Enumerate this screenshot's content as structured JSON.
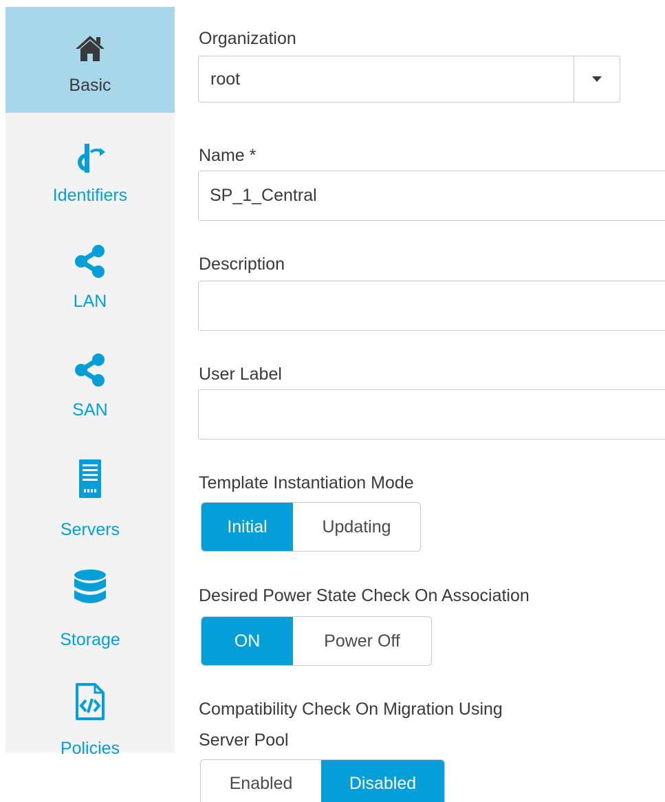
{
  "colors": {
    "accent": "#049fd9",
    "active_nav_bg": "#a9d7ea",
    "sidebar_bg": "#f3f3f3"
  },
  "sidebar": {
    "items": [
      {
        "label": "Basic",
        "icon": "home-icon",
        "active": true
      },
      {
        "label": "Identifiers",
        "icon": "identifiers-icon",
        "active": false
      },
      {
        "label": "LAN",
        "icon": "share-icon",
        "active": false
      },
      {
        "label": "SAN",
        "icon": "share-icon",
        "active": false
      },
      {
        "label": "Servers",
        "icon": "server-icon",
        "active": false
      },
      {
        "label": "Storage",
        "icon": "database-icon",
        "active": false
      },
      {
        "label": "Policies",
        "icon": "code-file-icon",
        "active": false
      }
    ]
  },
  "form": {
    "organization": {
      "label": "Organization",
      "value": "root"
    },
    "name": {
      "label": "Name *",
      "value": "SP_1_Central"
    },
    "description": {
      "label": "Description",
      "value": ""
    },
    "user_label": {
      "label": "User Label",
      "value": ""
    },
    "template_mode": {
      "label": "Template Instantiation Mode",
      "options": [
        "Initial",
        "Updating"
      ],
      "selected": "Initial"
    },
    "power_state": {
      "label": "Desired Power State Check On Association",
      "options": [
        "ON",
        "Power Off"
      ],
      "selected": "ON"
    },
    "compat_check": {
      "label_line1": "Compatibility Check On Migration Using",
      "label_line2": "Server Pool",
      "options": [
        "Enabled",
        "Disabled"
      ],
      "selected": "Disabled"
    }
  }
}
